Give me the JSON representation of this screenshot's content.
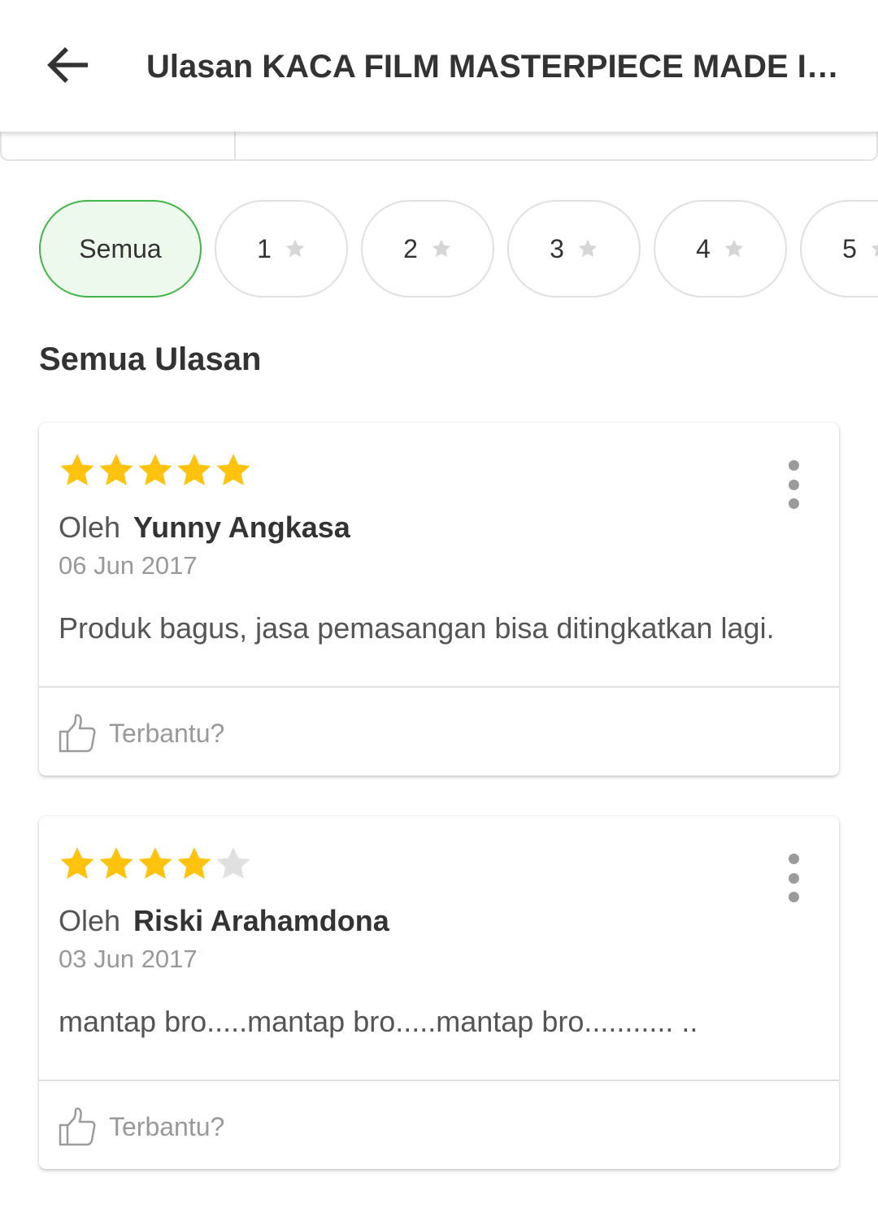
{
  "header": {
    "title": "Ulasan KACA FILM MASTERPIECE MADE IN INDONESIA",
    "back_icon": "arrow-left-icon"
  },
  "filters": {
    "chips": [
      {
        "label": "Semua",
        "active": true
      },
      {
        "label": "1",
        "active": false
      },
      {
        "label": "2",
        "active": false
      },
      {
        "label": "3",
        "active": false
      },
      {
        "label": "4",
        "active": false
      },
      {
        "label": "5",
        "active": false
      }
    ]
  },
  "section": {
    "title": "Semua Ulasan"
  },
  "reviews": [
    {
      "rating": 5,
      "by_label": "Oleh",
      "author": "Yunny Angkasa",
      "date": "06 Jun 2017",
      "text": "Produk bagus, jasa pemasangan bisa ditingkatkan lagi.",
      "helpful_label": "Terbantu?"
    },
    {
      "rating": 4,
      "by_label": "Oleh",
      "author": "Riski Arahamdona",
      "date": "03 Jun 2017",
      "text": "mantap bro.....mantap bro.....mantap bro........... ..",
      "helpful_label": "Terbantu?"
    }
  ],
  "colors": {
    "star_filled": "#ffc30e",
    "star_empty": "#e0e0e0",
    "accent_green": "#42b549",
    "chip_active_bg": "#eef9ee"
  }
}
